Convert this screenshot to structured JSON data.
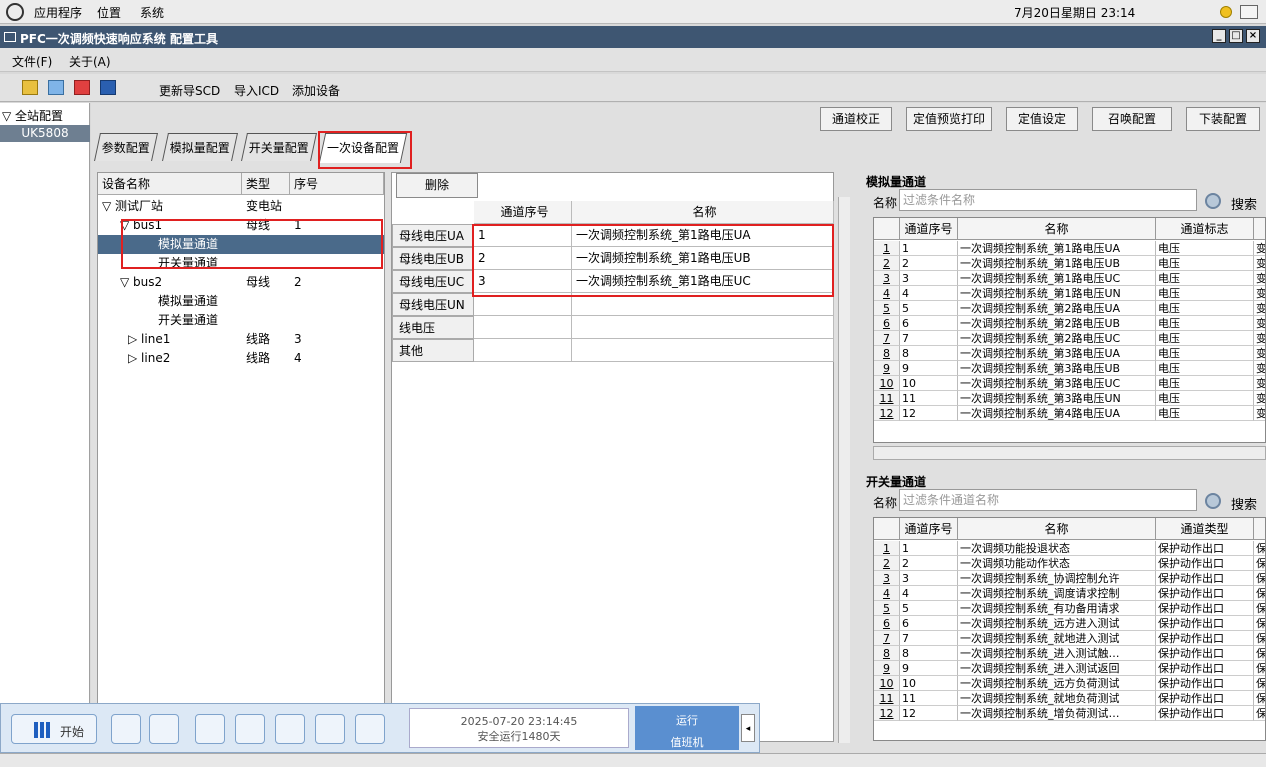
{
  "sysbar": {
    "apps": "应用程序",
    "places": "位置",
    "system": "系统",
    "datetime": "7月20日星期日 23:14"
  },
  "window": {
    "title": "PFC一次调频快速响应系统 配置工具",
    "min": "_",
    "max": "□",
    "close": "×"
  },
  "menu": {
    "file": "文件(F)",
    "about": "关于(A)"
  },
  "toolbar": {
    "update_scd": "更新导SCD",
    "import_icd": "导入ICD",
    "add_device": "添加设备"
  },
  "lefttree": {
    "root": "全站配置",
    "node": "UK5808"
  },
  "topbuttons": [
    "通道校正",
    "定值预览打印",
    "定值设定",
    "召唤配置",
    "下装配置"
  ],
  "tabs": [
    "参数配置",
    "模拟量配置",
    "开关量配置",
    "一次设备配置"
  ],
  "devtree": {
    "headers": [
      "设备名称",
      "类型",
      "序号"
    ],
    "rows": [
      {
        "name": "▽ 测试厂站",
        "type": "变电站",
        "num": ""
      },
      {
        "name": "▽ bus1",
        "type": "母线",
        "num": "1"
      },
      {
        "name": "模拟量通道",
        "type": "",
        "num": ""
      },
      {
        "name": "开关量通道",
        "type": "",
        "num": ""
      },
      {
        "name": "▽ bus2",
        "type": "母线",
        "num": "2"
      },
      {
        "name": "模拟量通道",
        "type": "",
        "num": ""
      },
      {
        "name": "开关量通道",
        "type": "",
        "num": ""
      },
      {
        "name": "▷ line1",
        "type": "线路",
        "num": "3"
      },
      {
        "name": "▷ line2",
        "type": "线路",
        "num": "4"
      }
    ]
  },
  "mid": {
    "delete": "删除",
    "headers": [
      "通道序号",
      "名称"
    ],
    "rows": [
      {
        "label": "母线电压UA",
        "ch": "1",
        "name": "一次调频控制系统_第1路电压UA"
      },
      {
        "label": "母线电压UB",
        "ch": "2",
        "name": "一次调频控制系统_第1路电压UB"
      },
      {
        "label": "母线电压UC",
        "ch": "3",
        "name": "一次调频控制系统_第1路电压UC"
      },
      {
        "label": "母线电压UN",
        "ch": "",
        "name": ""
      },
      {
        "label": "线电压",
        "ch": "",
        "name": ""
      },
      {
        "label": "其他",
        "ch": "",
        "name": ""
      }
    ]
  },
  "analog": {
    "title": "模拟量通道",
    "name_label": "名称",
    "placeholder": "过滤条件名称",
    "search": "搜索",
    "headers": [
      "通道序号",
      "名称",
      "通道标志"
    ],
    "rows": [
      [
        "1",
        "1",
        "一次调频控制系统_第1路电压UA",
        "电压",
        "变"
      ],
      [
        "2",
        "2",
        "一次调频控制系统_第1路电压UB",
        "电压",
        "变"
      ],
      [
        "3",
        "3",
        "一次调频控制系统_第1路电压UC",
        "电压",
        "变"
      ],
      [
        "4",
        "4",
        "一次调频控制系统_第1路电压UN",
        "电压",
        "变"
      ],
      [
        "5",
        "5",
        "一次调频控制系统_第2路电压UA",
        "电压",
        "变"
      ],
      [
        "6",
        "6",
        "一次调频控制系统_第2路电压UB",
        "电压",
        "变"
      ],
      [
        "7",
        "7",
        "一次调频控制系统_第2路电压UC",
        "电压",
        "变"
      ],
      [
        "8",
        "8",
        "一次调频控制系统_第3路电压UA",
        "电压",
        "变"
      ],
      [
        "9",
        "9",
        "一次调频控制系统_第3路电压UB",
        "电压",
        "变"
      ],
      [
        "10",
        "10",
        "一次调频控制系统_第3路电压UC",
        "电压",
        "变"
      ],
      [
        "11",
        "11",
        "一次调频控制系统_第3路电压UN",
        "电压",
        "变"
      ],
      [
        "12",
        "12",
        "一次调频控制系统_第4路电压UA",
        "电压",
        "变"
      ]
    ]
  },
  "digital": {
    "title": "开关量通道",
    "name_label": "名称",
    "placeholder": "过滤条件通道名称",
    "search": "搜索",
    "headers": [
      "通道序号",
      "名称",
      "通道类型"
    ],
    "rows": [
      [
        "1",
        "1",
        "一次调频功能投退状态",
        "保护动作出口",
        "保"
      ],
      [
        "2",
        "2",
        "一次调频功能动作状态",
        "保护动作出口",
        "保"
      ],
      [
        "3",
        "3",
        "一次调频控制系统_协调控制允许",
        "保护动作出口",
        "保"
      ],
      [
        "4",
        "4",
        "一次调频控制系统_调度请求控制",
        "保护动作出口",
        "保"
      ],
      [
        "5",
        "5",
        "一次调频控制系统_有功备用请求",
        "保护动作出口",
        "保"
      ],
      [
        "6",
        "6",
        "一次调频控制系统_远方进入测试",
        "保护动作出口",
        "保"
      ],
      [
        "7",
        "7",
        "一次调频控制系统_就地进入测试",
        "保护动作出口",
        "保"
      ],
      [
        "8",
        "8",
        "一次调频控制系统_进入测试触…",
        "保护动作出口",
        "保"
      ],
      [
        "9",
        "9",
        "一次调频控制系统_进入测试返回",
        "保护动作出口",
        "保"
      ],
      [
        "10",
        "10",
        "一次调频控制系统_远方负荷测试",
        "保护动作出口",
        "保"
      ],
      [
        "11",
        "11",
        "一次调频控制系统_就地负荷测试",
        "保护动作出口",
        "保"
      ],
      [
        "12",
        "12",
        "一次调频控制系统_增负荷测试…",
        "保护动作出口",
        "保"
      ]
    ]
  },
  "taskbar": {
    "start": "开始",
    "datetime": "2025-07-20 23:14:45",
    "uptime": "安全运行1480天",
    "status": "运行",
    "role": "值班机"
  }
}
